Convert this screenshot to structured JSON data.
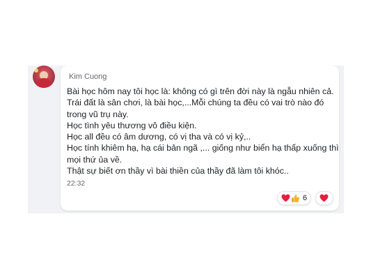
{
  "comment": {
    "author": "Kim Cuong",
    "lines": [
      "Bài học hôm nay tôi học là: không có gì trên đời này là ngẫu nhiên cả.",
      "Trái đất là sân chơi, là bài học,...Mỗi chúng ta đều có vai trò nào đó",
      "trong vũ trụ này.",
      "Học tình yêu thương vô điều kiện.",
      "Học all đều có âm dương, có vị tha và có vị kỷ,..",
      "Học tính khiêm hạ, hạ cái bản ngã ,... giống như biển hạ thấp xuống thì",
      "mọi thứ ủa về.",
      "Thật sự biết ơn thầy vì bài thiền của thầy đã làm tôi khóc.."
    ],
    "timestamp": "22:32"
  },
  "reactions": {
    "types": [
      "heart-icon",
      "like-icon"
    ],
    "count": "6",
    "own_reaction": "heart-icon"
  },
  "colors": {
    "background": "#f0f2f5",
    "bubble": "#ffffff",
    "text": "#1c1e21",
    "secondary_text": "#65676b",
    "heart": "#e41e3f",
    "like": "#f7b125"
  }
}
